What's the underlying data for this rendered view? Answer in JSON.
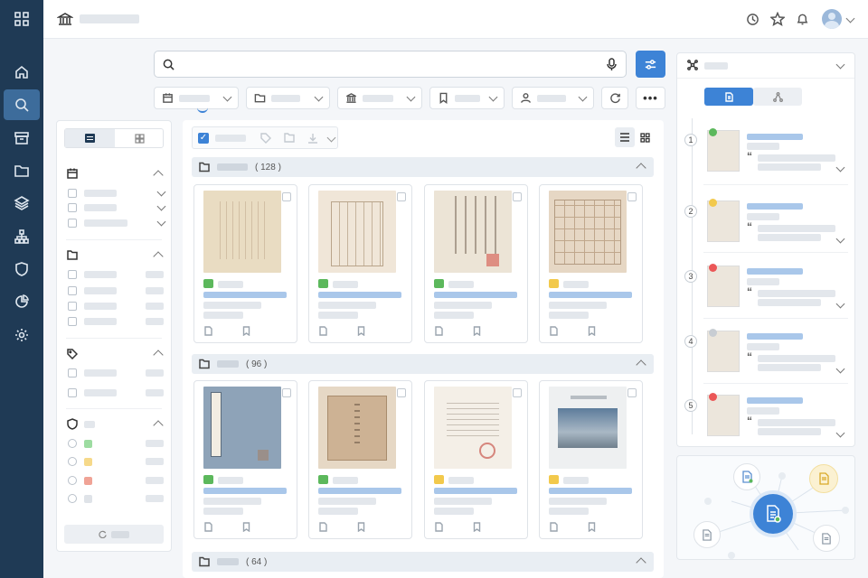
{
  "groups": [
    {
      "count": "( 128 )"
    },
    {
      "count": "( 96 )"
    },
    {
      "count": "( 64 )"
    }
  ],
  "timeline": {
    "numbers": [
      "1",
      "2",
      "3",
      "4",
      "5"
    ]
  },
  "colors": {
    "rail": "#1f3a55",
    "accent": "#3d83d6",
    "badge_green": "#5cb85c",
    "badge_yellow": "#f2c94c",
    "badge_red": "#eb5757"
  },
  "icons": {
    "rail": [
      "grid-icon",
      "home-icon",
      "search-icon",
      "archive-box-icon",
      "folder-icon",
      "layers-icon",
      "hierarchy-icon",
      "shield-icon",
      "pie-chart-icon",
      "gear-icon"
    ]
  }
}
